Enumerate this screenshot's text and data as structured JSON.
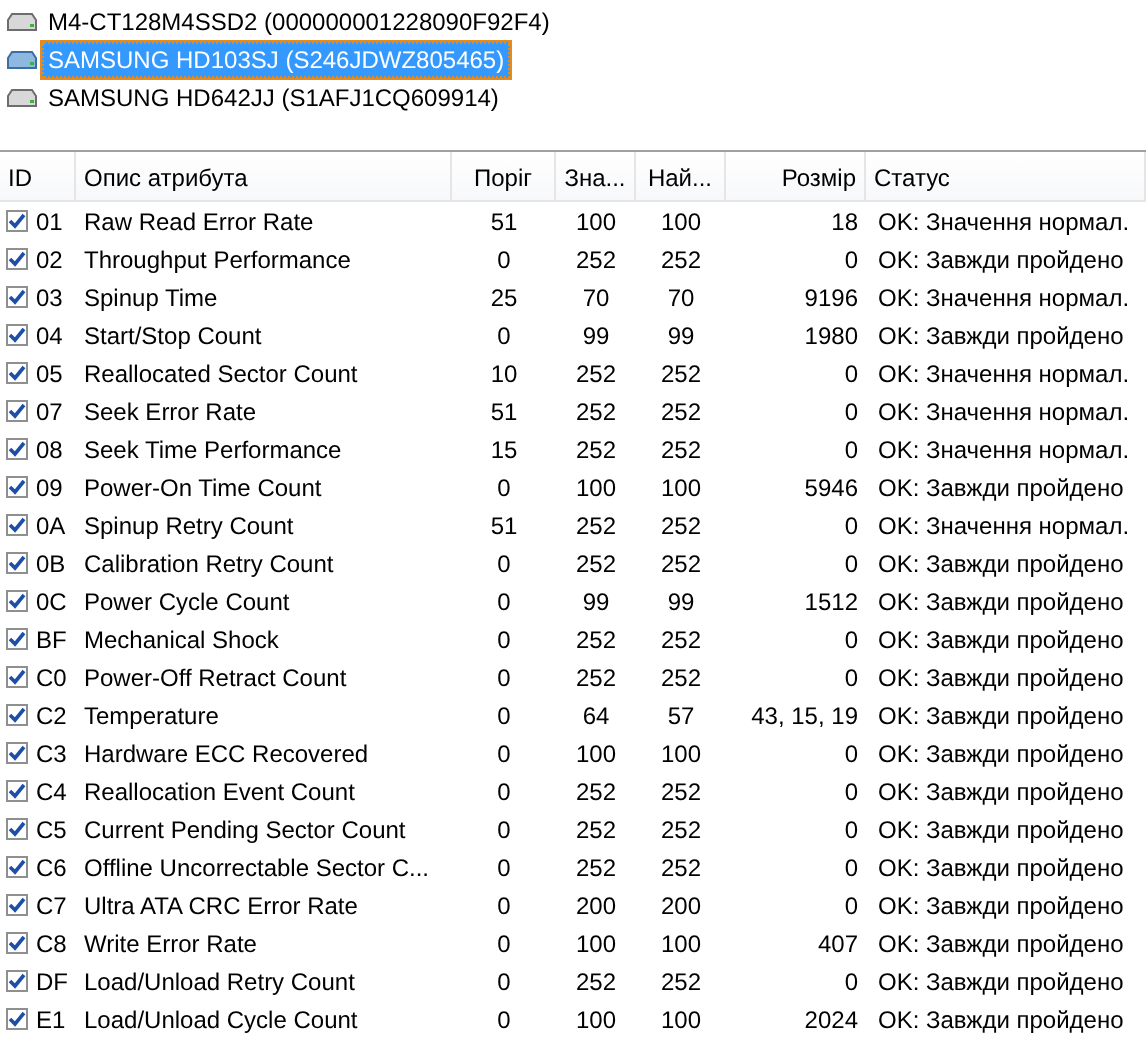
{
  "drives": [
    {
      "label": "M4-CT128M4SSD2 (000000001228090F92F4)",
      "selected": false
    },
    {
      "label": "SAMSUNG HD103SJ (S246JDWZ805465)",
      "selected": true
    },
    {
      "label": "SAMSUNG HD642JJ (S1AFJ1CQ609914)",
      "selected": false
    }
  ],
  "table": {
    "columns": [
      "ID",
      "Опис атрибута",
      "Поріг",
      "Зна...",
      "Най...",
      "Розмір",
      "Статус"
    ],
    "rows": [
      {
        "checked": true,
        "id": "01",
        "name": "Raw Read Error Rate",
        "threshold": "51",
        "value": "100",
        "worst": "100",
        "raw": "18",
        "status": "OK: Значення нормал."
      },
      {
        "checked": true,
        "id": "02",
        "name": "Throughput Performance",
        "threshold": "0",
        "value": "252",
        "worst": "252",
        "raw": "0",
        "status": "OK: Завжди пройдено"
      },
      {
        "checked": true,
        "id": "03",
        "name": "Spinup Time",
        "threshold": "25",
        "value": "70",
        "worst": "70",
        "raw": "9196",
        "status": "OK: Значення нормал."
      },
      {
        "checked": true,
        "id": "04",
        "name": "Start/Stop Count",
        "threshold": "0",
        "value": "99",
        "worst": "99",
        "raw": "1980",
        "status": "OK: Завжди пройдено"
      },
      {
        "checked": true,
        "id": "05",
        "name": "Reallocated Sector Count",
        "threshold": "10",
        "value": "252",
        "worst": "252",
        "raw": "0",
        "status": "OK: Значення нормал."
      },
      {
        "checked": true,
        "id": "07",
        "name": "Seek Error Rate",
        "threshold": "51",
        "value": "252",
        "worst": "252",
        "raw": "0",
        "status": "OK: Значення нормал."
      },
      {
        "checked": true,
        "id": "08",
        "name": "Seek Time Performance",
        "threshold": "15",
        "value": "252",
        "worst": "252",
        "raw": "0",
        "status": "OK: Значення нормал."
      },
      {
        "checked": true,
        "id": "09",
        "name": "Power-On Time Count",
        "threshold": "0",
        "value": "100",
        "worst": "100",
        "raw": "5946",
        "status": "OK: Завжди пройдено"
      },
      {
        "checked": true,
        "id": "0A",
        "name": "Spinup Retry Count",
        "threshold": "51",
        "value": "252",
        "worst": "252",
        "raw": "0",
        "status": "OK: Значення нормал."
      },
      {
        "checked": true,
        "id": "0B",
        "name": "Calibration Retry Count",
        "threshold": "0",
        "value": "252",
        "worst": "252",
        "raw": "0",
        "status": "OK: Завжди пройдено"
      },
      {
        "checked": true,
        "id": "0C",
        "name": "Power Cycle Count",
        "threshold": "0",
        "value": "99",
        "worst": "99",
        "raw": "1512",
        "status": "OK: Завжди пройдено"
      },
      {
        "checked": true,
        "id": "BF",
        "name": "Mechanical Shock",
        "threshold": "0",
        "value": "252",
        "worst": "252",
        "raw": "0",
        "status": "OK: Завжди пройдено"
      },
      {
        "checked": true,
        "id": "C0",
        "name": "Power-Off Retract Count",
        "threshold": "0",
        "value": "252",
        "worst": "252",
        "raw": "0",
        "status": "OK: Завжди пройдено"
      },
      {
        "checked": true,
        "id": "C2",
        "name": "Temperature",
        "threshold": "0",
        "value": "64",
        "worst": "57",
        "raw": "43, 15, 19",
        "status": "OK: Завжди пройдено"
      },
      {
        "checked": true,
        "id": "C3",
        "name": "Hardware ECC Recovered",
        "threshold": "0",
        "value": "100",
        "worst": "100",
        "raw": "0",
        "status": "OK: Завжди пройдено"
      },
      {
        "checked": true,
        "id": "C4",
        "name": "Reallocation Event Count",
        "threshold": "0",
        "value": "252",
        "worst": "252",
        "raw": "0",
        "status": "OK: Завжди пройдено"
      },
      {
        "checked": true,
        "id": "C5",
        "name": "Current Pending Sector Count",
        "threshold": "0",
        "value": "252",
        "worst": "252",
        "raw": "0",
        "status": "OK: Завжди пройдено"
      },
      {
        "checked": true,
        "id": "C6",
        "name": "Offline Uncorrectable Sector C...",
        "threshold": "0",
        "value": "252",
        "worst": "252",
        "raw": "0",
        "status": "OK: Завжди пройдено"
      },
      {
        "checked": true,
        "id": "C7",
        "name": "Ultra ATA CRC Error Rate",
        "threshold": "0",
        "value": "200",
        "worst": "200",
        "raw": "0",
        "status": "OK: Завжди пройдено"
      },
      {
        "checked": true,
        "id": "C8",
        "name": "Write Error Rate",
        "threshold": "0",
        "value": "100",
        "worst": "100",
        "raw": "407",
        "status": "OK: Завжди пройдено"
      },
      {
        "checked": true,
        "id": "DF",
        "name": "Load/Unload Retry Count",
        "threshold": "0",
        "value": "252",
        "worst": "252",
        "raw": "0",
        "status": "OK: Завжди пройдено"
      },
      {
        "checked": true,
        "id": "E1",
        "name": "Load/Unload Cycle Count",
        "threshold": "0",
        "value": "100",
        "worst": "100",
        "raw": "2024",
        "status": "OK: Завжди пройдено"
      }
    ]
  }
}
